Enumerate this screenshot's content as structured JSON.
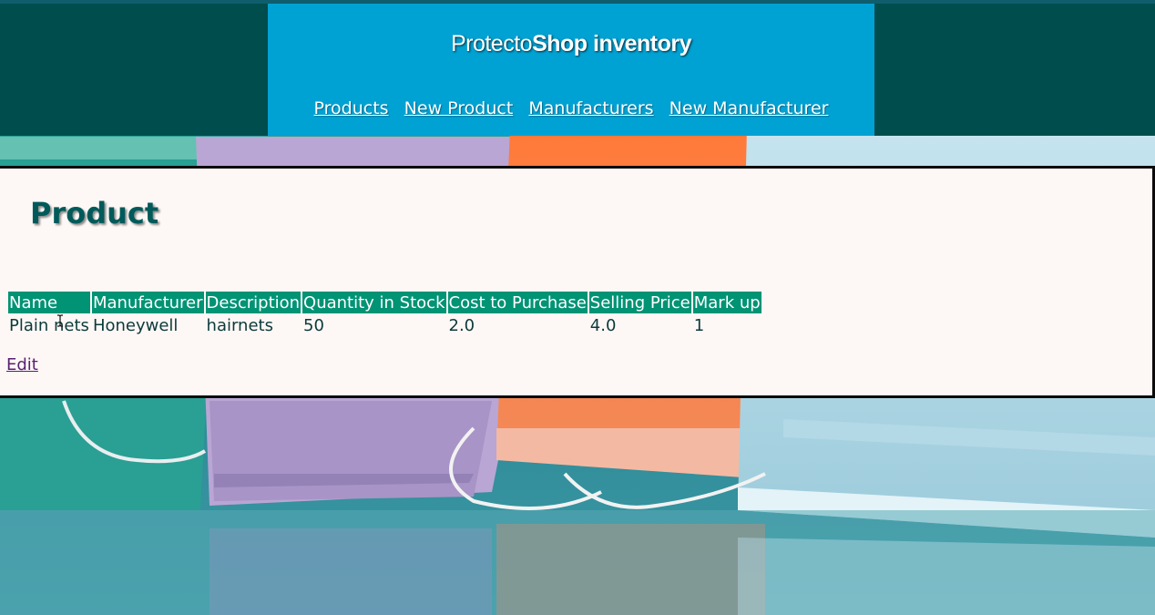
{
  "header": {
    "brand_thin": "Protecto",
    "brand_bold": "Shop inventory",
    "nav": [
      {
        "label": "Products"
      },
      {
        "label": "New Product"
      },
      {
        "label": "Manufacturers"
      },
      {
        "label": "New Manufacturer"
      }
    ]
  },
  "main": {
    "title": "Product",
    "table": {
      "columns": [
        "Name",
        "Manufacturer",
        "Description",
        "Quantity in Stock",
        "Cost to Purchase",
        "Selling Price",
        "Mark up"
      ],
      "rows": [
        [
          "Plain nets",
          "Honeywell",
          "hairnets",
          "50",
          "2.0",
          "4.0",
          "1"
        ]
      ]
    },
    "edit_label": "Edit"
  },
  "colors": {
    "header_band": "#004d4d",
    "header_panel": "#00a2d3",
    "table_header": "#009374",
    "card_background": "#fdf8f6",
    "title": "#005a5a"
  },
  "icons": {
    "background": "face-masks-photo",
    "cursor": "text-cursor-icon"
  }
}
